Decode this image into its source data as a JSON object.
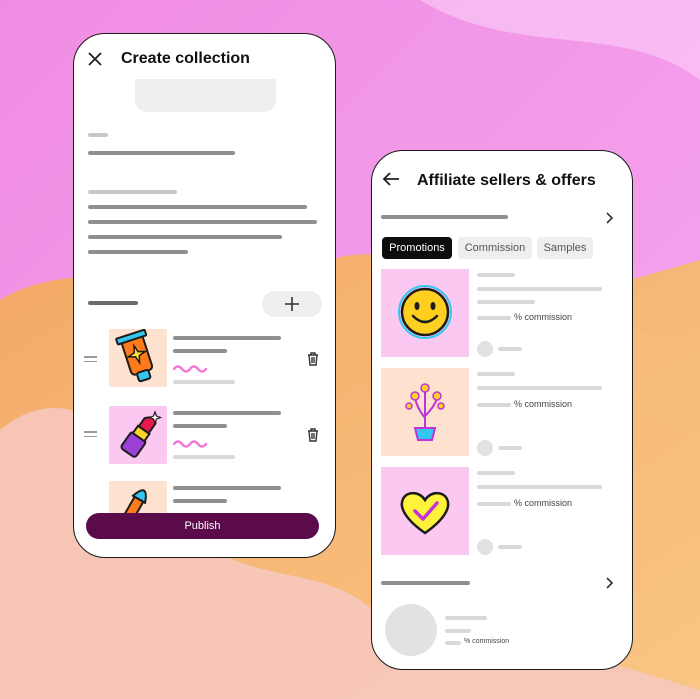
{
  "colors": {
    "accent": "#5b0a4a",
    "bg_pink": "#f29ae8",
    "bg_orange": "#f7b36b",
    "tab_active": "#0d0d0d",
    "thumb_pink": "#fac8f0",
    "thumb_peach": "#fde3cf"
  },
  "collection_screen": {
    "close_icon": "close-icon",
    "title": "Create collection",
    "add_icon": "plus-icon",
    "items": [
      {
        "sticker": "lotion-tube-sticker",
        "squiggle": true
      },
      {
        "sticker": "lipstick-sticker",
        "squiggle": true
      },
      {
        "sticker": "makeup-brush-sticker",
        "squiggle": false
      }
    ],
    "delete_icon": "trash-icon",
    "publish_label": "Publish"
  },
  "affiliate_screen": {
    "back_icon": "arrow-left-icon",
    "title": "Affiliate sellers & offers",
    "tabs": [
      {
        "label": "Promotions",
        "active": true
      },
      {
        "label": "Commission",
        "active": false
      },
      {
        "label": "Samples",
        "active": false
      }
    ],
    "offers": [
      {
        "sticker": "smiley-face-sticker",
        "commission_label": "% commission"
      },
      {
        "sticker": "flower-pot-sticker",
        "commission_label": "% commission"
      },
      {
        "sticker": "heart-check-sticker",
        "commission_label": "% commission"
      }
    ],
    "bottom_offer": {
      "commission_label": "% commission"
    },
    "chevron_icon": "chevron-right-icon"
  }
}
